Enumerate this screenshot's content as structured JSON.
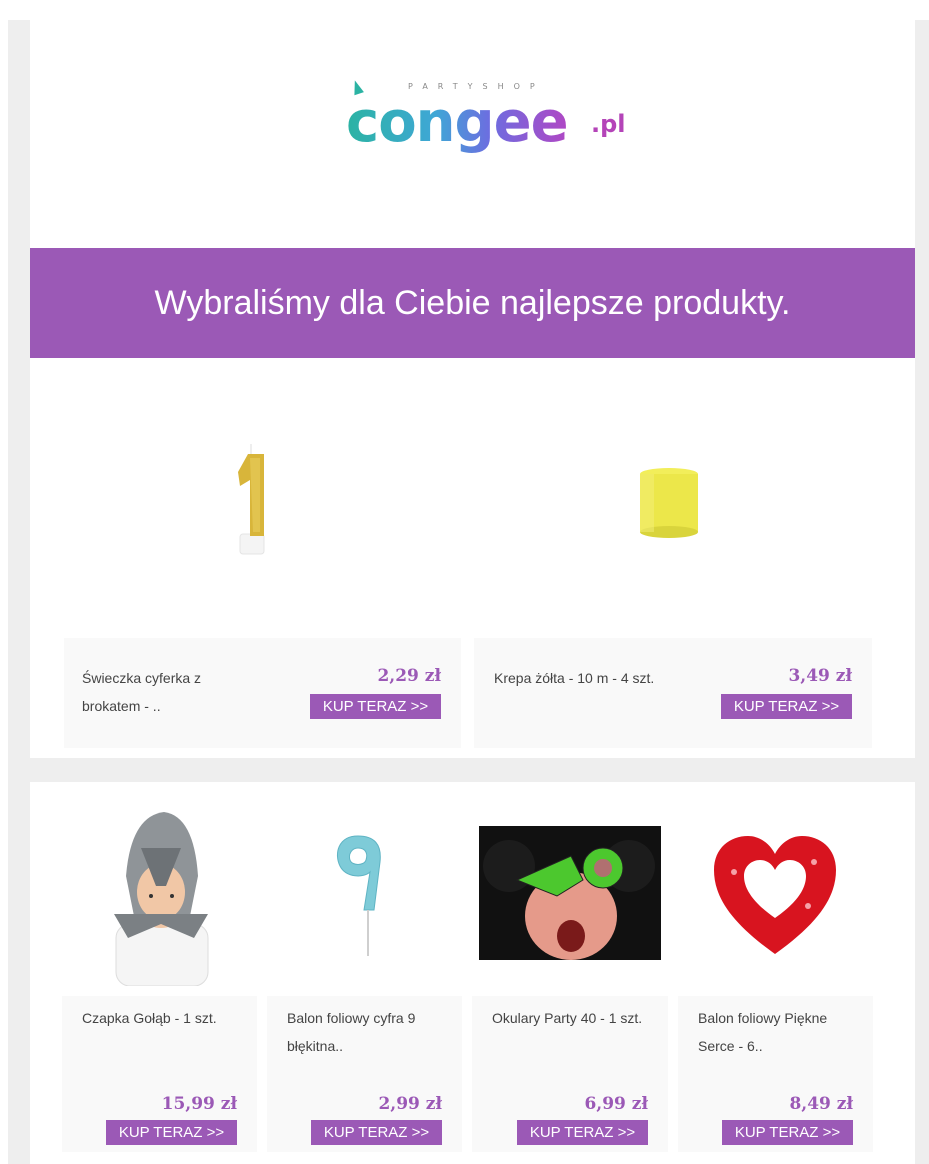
{
  "logo": {
    "tagline": "PARTYSHOP",
    "word": "congee",
    "suffix": ".pl"
  },
  "banner": {
    "title": "Wybraliśmy dla Ciebie najlepsze produkty."
  },
  "featured": [
    {
      "name": "Świeczka cyferka z brokatem - ..",
      "price": "2,29 zł",
      "cta": "KUP TERAZ >>"
    },
    {
      "name": "Krepa żółta - 10 m - 4 szt.",
      "price": "3,49 zł",
      "cta": "KUP TERAZ >>"
    }
  ],
  "products": [
    {
      "name": "Czapka Gołąb - 1 szt.",
      "price": "15,99 zł",
      "cta": "KUP TERAZ >>"
    },
    {
      "name": "Balon foliowy cyfra 9 błękitna..",
      "price": "2,99 zł",
      "cta": "KUP TERAZ >>"
    },
    {
      "name": "Okulary Party 40 - 1 szt.",
      "price": "6,99 zł",
      "cta": "KUP TERAZ >>"
    },
    {
      "name": "Balon foliowy Piękne Serce - 6..",
      "price": "8,49 zł",
      "cta": "KUP TERAZ >>"
    }
  ],
  "colors": {
    "accent": "#9b59b6",
    "background": "#eeeeee",
    "card": "#ffffff",
    "info": "#f9f9f9"
  }
}
